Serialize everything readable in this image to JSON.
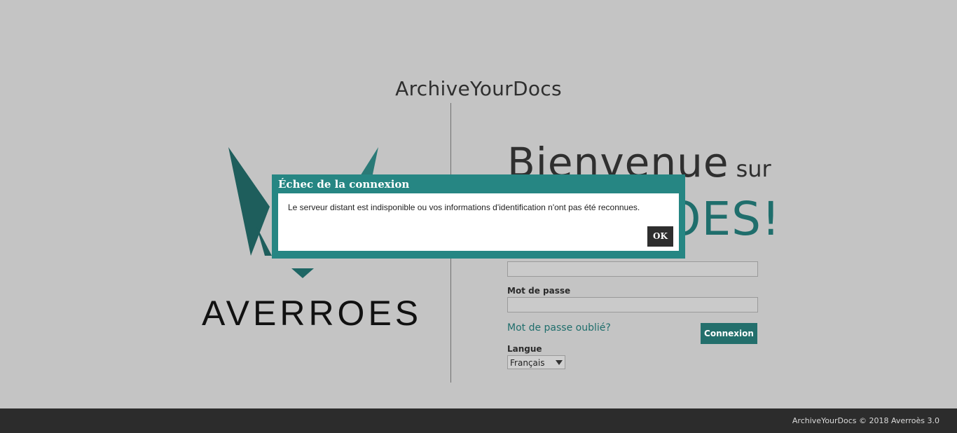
{
  "header": {
    "app_title": "ArchiveYourDocs"
  },
  "logo": {
    "wordmark": "AVERROES",
    "color_dark": "#1e5e5c",
    "color_mid": "#2a7a77"
  },
  "welcome": {
    "line1_big": "Bienvenue",
    "line1_small": "sur",
    "line2": "AVERROES!"
  },
  "form": {
    "username_value": "",
    "password_label": "Mot de passe",
    "password_value": "",
    "forgot_link": "Mot de passe oublié?",
    "login_button": "Connexion",
    "language_label": "Langue",
    "language_selected": "Français"
  },
  "footer": {
    "text": "ArchiveYourDocs © 2018 Averroès 3.0"
  },
  "dialog": {
    "title": "Échec de la connexion",
    "message": "Le serveur distant est indisponible ou vos informations d'identification n'ont pas été reconnues.",
    "ok_button": "OK"
  },
  "colors": {
    "background": "#c4c4c4",
    "accent": "#268683",
    "footer": "#2c2c2c"
  }
}
